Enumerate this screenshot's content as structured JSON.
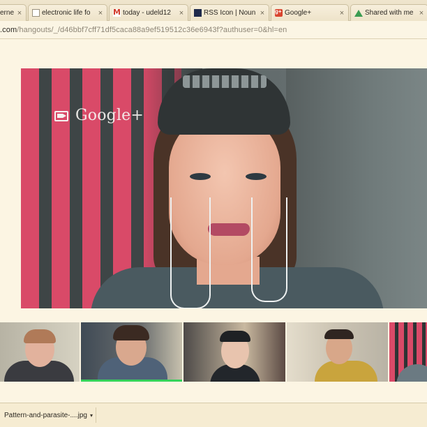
{
  "tabs": [
    {
      "title": "ernet",
      "favicon": "doc-icon",
      "close": "×"
    },
    {
      "title": "electronic life fo",
      "favicon": "doc-icon",
      "close": "×"
    },
    {
      "title": "today - udeld12",
      "favicon": "gmail-icon",
      "close": "×"
    },
    {
      "title": "RSS Icon | Noun",
      "favicon": "noun-project-icon",
      "close": "×"
    },
    {
      "title": "Google+",
      "favicon": "google-plus-icon",
      "close": "×"
    },
    {
      "title": "Shared with me",
      "favicon": "drive-icon",
      "close": "×"
    }
  ],
  "address": {
    "host": ".com",
    "path": "/hangouts/_/d46bbf7cff71df5caca88a9ef519512c36e6943f?authuser=0&hl=en"
  },
  "hangout": {
    "brand_label": "Google+",
    "brand_icon": "hangouts-camera-icon",
    "participants": [
      {
        "label": "participant-1",
        "active": false
      },
      {
        "label": "participant-2",
        "active": true
      },
      {
        "label": "participant-3",
        "active": false
      },
      {
        "label": "participant-4",
        "active": false
      },
      {
        "label": "participant-5",
        "active": false
      }
    ],
    "active_color": "#35d25a"
  },
  "downloads": {
    "file_name": "Pattern-and-parasite-....jpg",
    "menu_arrow": "▾"
  }
}
